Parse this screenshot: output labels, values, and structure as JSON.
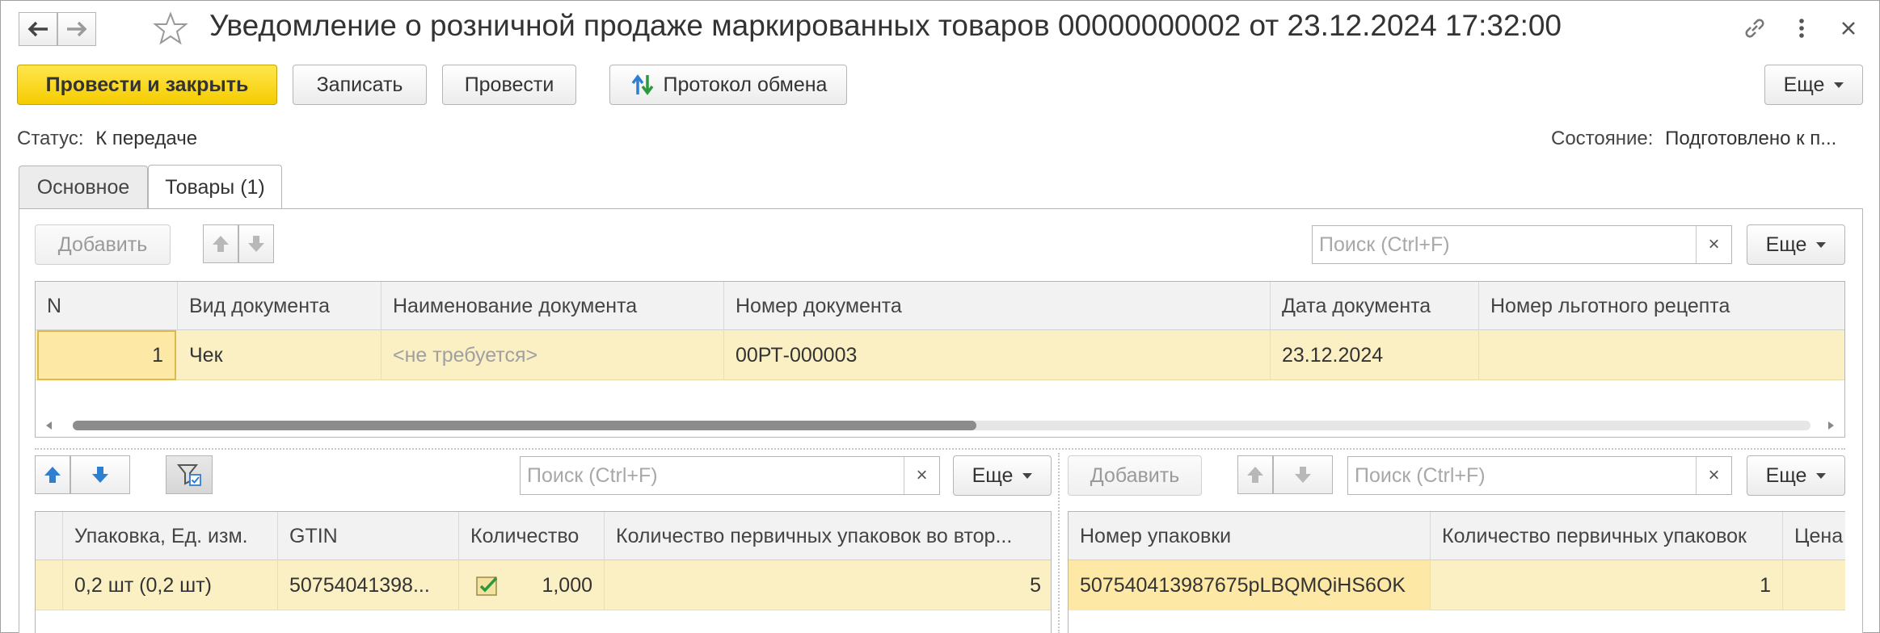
{
  "window": {
    "title": "Уведомление о розничной продаже маркированных товаров 00000000002 от 23.12.2024 17:32:00"
  },
  "icons": {
    "back": "arrow-left-icon",
    "forward": "arrow-right-icon",
    "favorite": "star-icon",
    "link": "link-icon",
    "menu": "kebab-menu-icon",
    "close": "close-icon",
    "exchange": "exchange-protocol-icon"
  },
  "toolbar": {
    "post_close": "Провести и закрыть",
    "save": "Записать",
    "post": "Провести",
    "protocol": "Протокол обмена",
    "more": "Еще"
  },
  "status": {
    "status_label": "Статус:",
    "status_value": "К передаче",
    "state_label": "Состояние:",
    "state_value": "Подготовлено к п..."
  },
  "tabs": [
    {
      "label": "Основное",
      "active": false
    },
    {
      "label": "Товары (1)",
      "active": true
    }
  ],
  "documents": {
    "add": "Добавить",
    "search_placeholder": "Поиск (Ctrl+F)",
    "search_clear": "×",
    "more": "Еще",
    "columns": [
      "N",
      "Вид документа",
      "Наименование документа",
      "Номер документа",
      "Дата документа",
      "Номер льготного рецепта"
    ],
    "rows": [
      {
        "n": "1",
        "type": "Чек",
        "name": "<не требуется>",
        "number": "00РТ-000003",
        "date": "23.12.2024",
        "recipe": ""
      }
    ],
    "scroll_position": 0.52
  },
  "goods": {
    "search_placeholder": "Поиск (Ctrl+F)",
    "search_clear": "×",
    "more": "Еще",
    "columns": [
      "Упаковка, Ед. изм.",
      "GTIN",
      "Количество",
      "Количество первичных упаковок во втор..."
    ],
    "rows": [
      {
        "pack": "0,2 шт (0,2 шт)",
        "gtin": "50754041398...",
        "qty": "1,000",
        "primary_qty": "5"
      }
    ]
  },
  "packages": {
    "add": "Добавить",
    "search_placeholder": "Поиск (Ctrl+F)",
    "search_clear": "×",
    "more": "Еще",
    "columns": [
      "Номер упаковки",
      "Количество первичных упаковок",
      "Цена"
    ],
    "rows": [
      {
        "code": "507540413987675pLBQMQiHS6OK",
        "primary_qty": "1",
        "price": ""
      }
    ]
  },
  "colors": {
    "primary": "#f5cc00",
    "row_selected": "#fbefc4",
    "header_bg": "#f2f2f2",
    "blue_arrow": "#2f7fd0"
  }
}
